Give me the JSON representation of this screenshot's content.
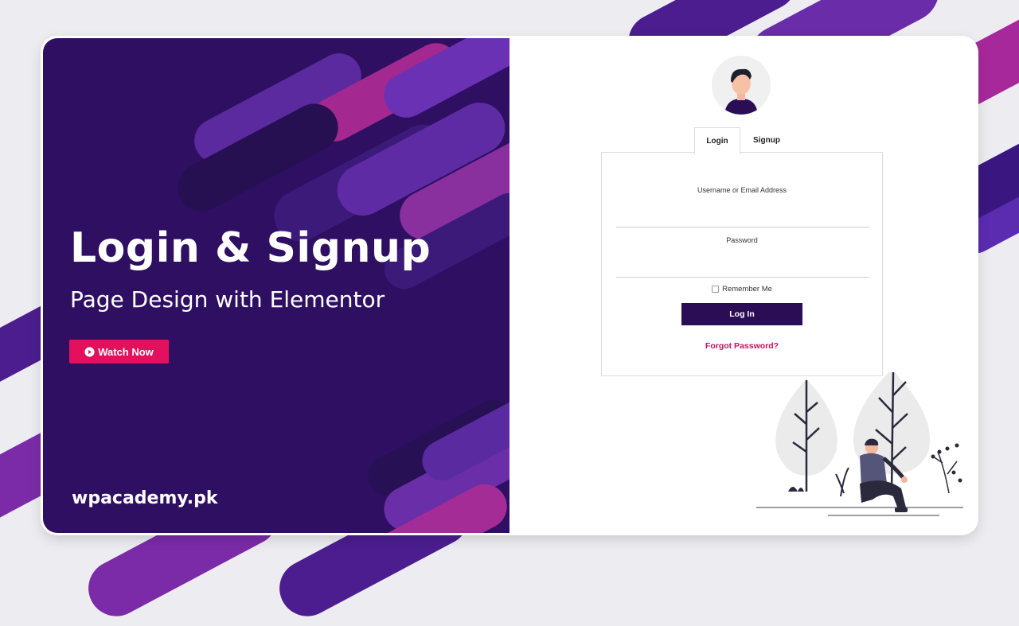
{
  "hero": {
    "title": "Login & Signup",
    "subtitle": "Page Design with Elementor",
    "watch_button": "Watch Now",
    "brand": "wpacademy.pk"
  },
  "tabs": [
    {
      "label": "Login",
      "active": true
    },
    {
      "label": "Signup",
      "active": false
    }
  ],
  "form": {
    "username_label": "Username or Email Address",
    "username_value": "",
    "password_label": "Password",
    "password_value": "",
    "remember_label": "Remember Me",
    "remember_checked": false,
    "login_button": "Log In",
    "forgot_link": "Forgot Password?"
  },
  "colors": {
    "primary_dark": "#2b0d55",
    "panel_bg": "#2e0f62",
    "accent_pink": "#e3115d",
    "link_pink": "#c2135c",
    "magenta": "#b22aa0",
    "violet": "#5b2bb0"
  },
  "icons": {
    "play": "play-circle-icon",
    "avatar": "user-avatar-icon",
    "illustration": "person-sitting-trees-illustration"
  }
}
